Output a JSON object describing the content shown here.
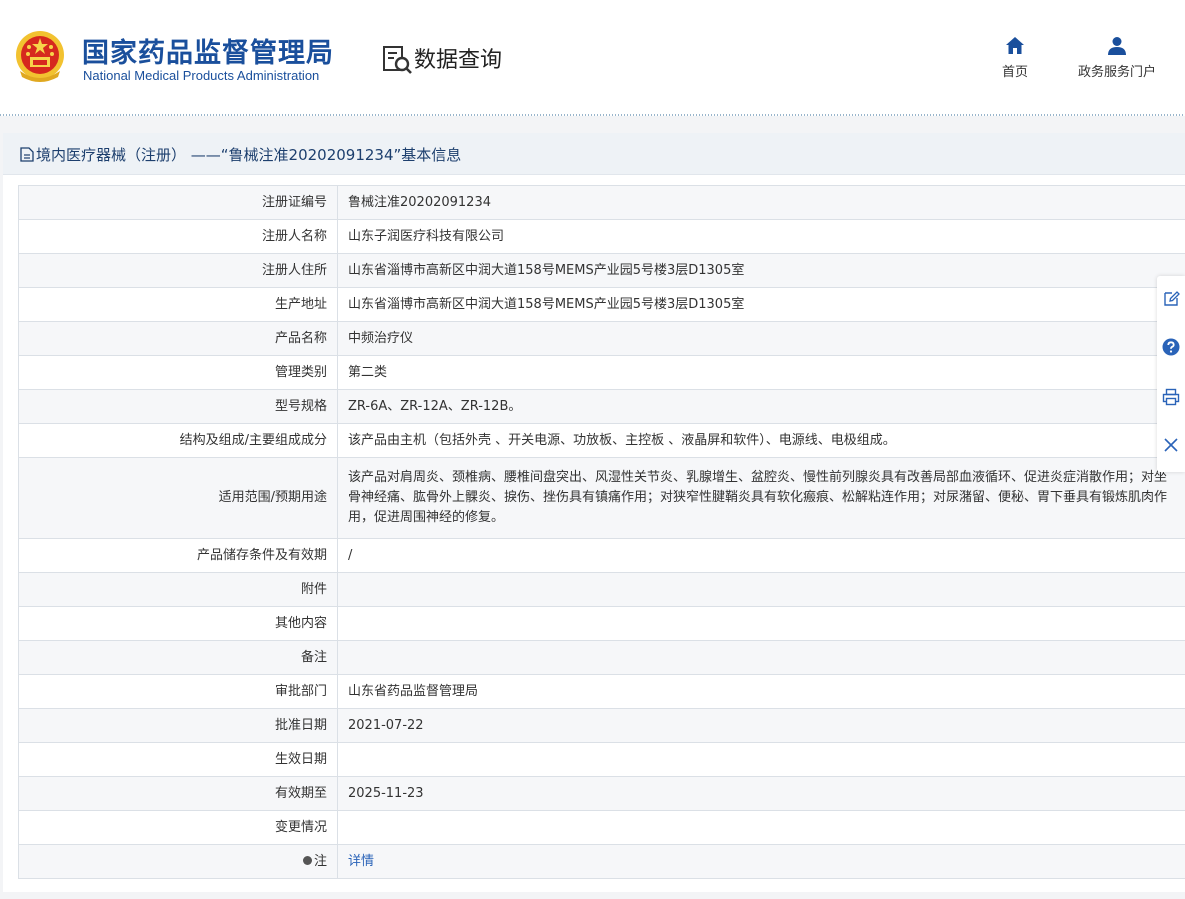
{
  "header": {
    "brand_cn": "国家药品监督管理局",
    "brand_en": "National Medical Products Administration",
    "section_label": "数据查询",
    "nav": [
      {
        "label": "首页",
        "icon": "home-icon"
      },
      {
        "label": "政务服务门户",
        "icon": "user-icon"
      }
    ]
  },
  "panel": {
    "title": "境内医疗器械（注册） ——“鲁械注准20202091234”基本信息"
  },
  "rows": [
    {
      "label": "注册证编号",
      "value": "鲁械注准20202091234"
    },
    {
      "label": "注册人名称",
      "value": "山东子润医疗科技有限公司"
    },
    {
      "label": "注册人住所",
      "value": "山东省淄博市高新区中润大道158号MEMS产业园5号楼3层D1305室"
    },
    {
      "label": "生产地址",
      "value": "山东省淄博市高新区中润大道158号MEMS产业园5号楼3层D1305室"
    },
    {
      "label": "产品名称",
      "value": "中频治疗仪"
    },
    {
      "label": "管理类别",
      "value": "第二类"
    },
    {
      "label": "型号规格",
      "value": "ZR-6A、ZR-12A、ZR-12B。"
    },
    {
      "label": "结构及组成/主要组成成分",
      "value": "该产品由主机（包括外壳 、开关电源、功放板、主控板 、液晶屏和软件）、电源线、电极组成。"
    },
    {
      "label": "适用范围/预期用途",
      "value": "该产品对肩周炎、颈椎病、腰椎间盘突出、风湿性关节炎、乳腺增生、盆腔炎、慢性前列腺炎具有改善局部血液循环、促进炎症消散作用；对坐骨神经痛、肱骨外上髁炎、捩伤、挫伤具有镇痛作用；对狭窄性腱鞘炎具有软化瘢痕、松解粘连作用；对尿潴留、便秘、胃下垂具有锻炼肌肉作用，促进周围神经的修复。"
    },
    {
      "label": "产品储存条件及有效期",
      "value": "/"
    },
    {
      "label": "附件",
      "value": ""
    },
    {
      "label": "其他内容",
      "value": ""
    },
    {
      "label": "备注",
      "value": ""
    },
    {
      "label": "审批部门",
      "value": "山东省药品监督管理局"
    },
    {
      "label": "批准日期",
      "value": "2021-07-22"
    },
    {
      "label": "生效日期",
      "value": ""
    },
    {
      "label": "有效期至",
      "value": "2025-11-23"
    },
    {
      "label": "变更情况",
      "value": ""
    },
    {
      "label": "注",
      "value": "详情"
    }
  ],
  "sidebar": [
    {
      "icon": "edit-icon"
    },
    {
      "icon": "help-icon"
    },
    {
      "icon": "print-icon"
    },
    {
      "icon": "close-icon"
    }
  ],
  "colors": {
    "brand": "#1a4f9c",
    "link": "#2a63b8",
    "panel_head_bg": "#eef2f6"
  }
}
